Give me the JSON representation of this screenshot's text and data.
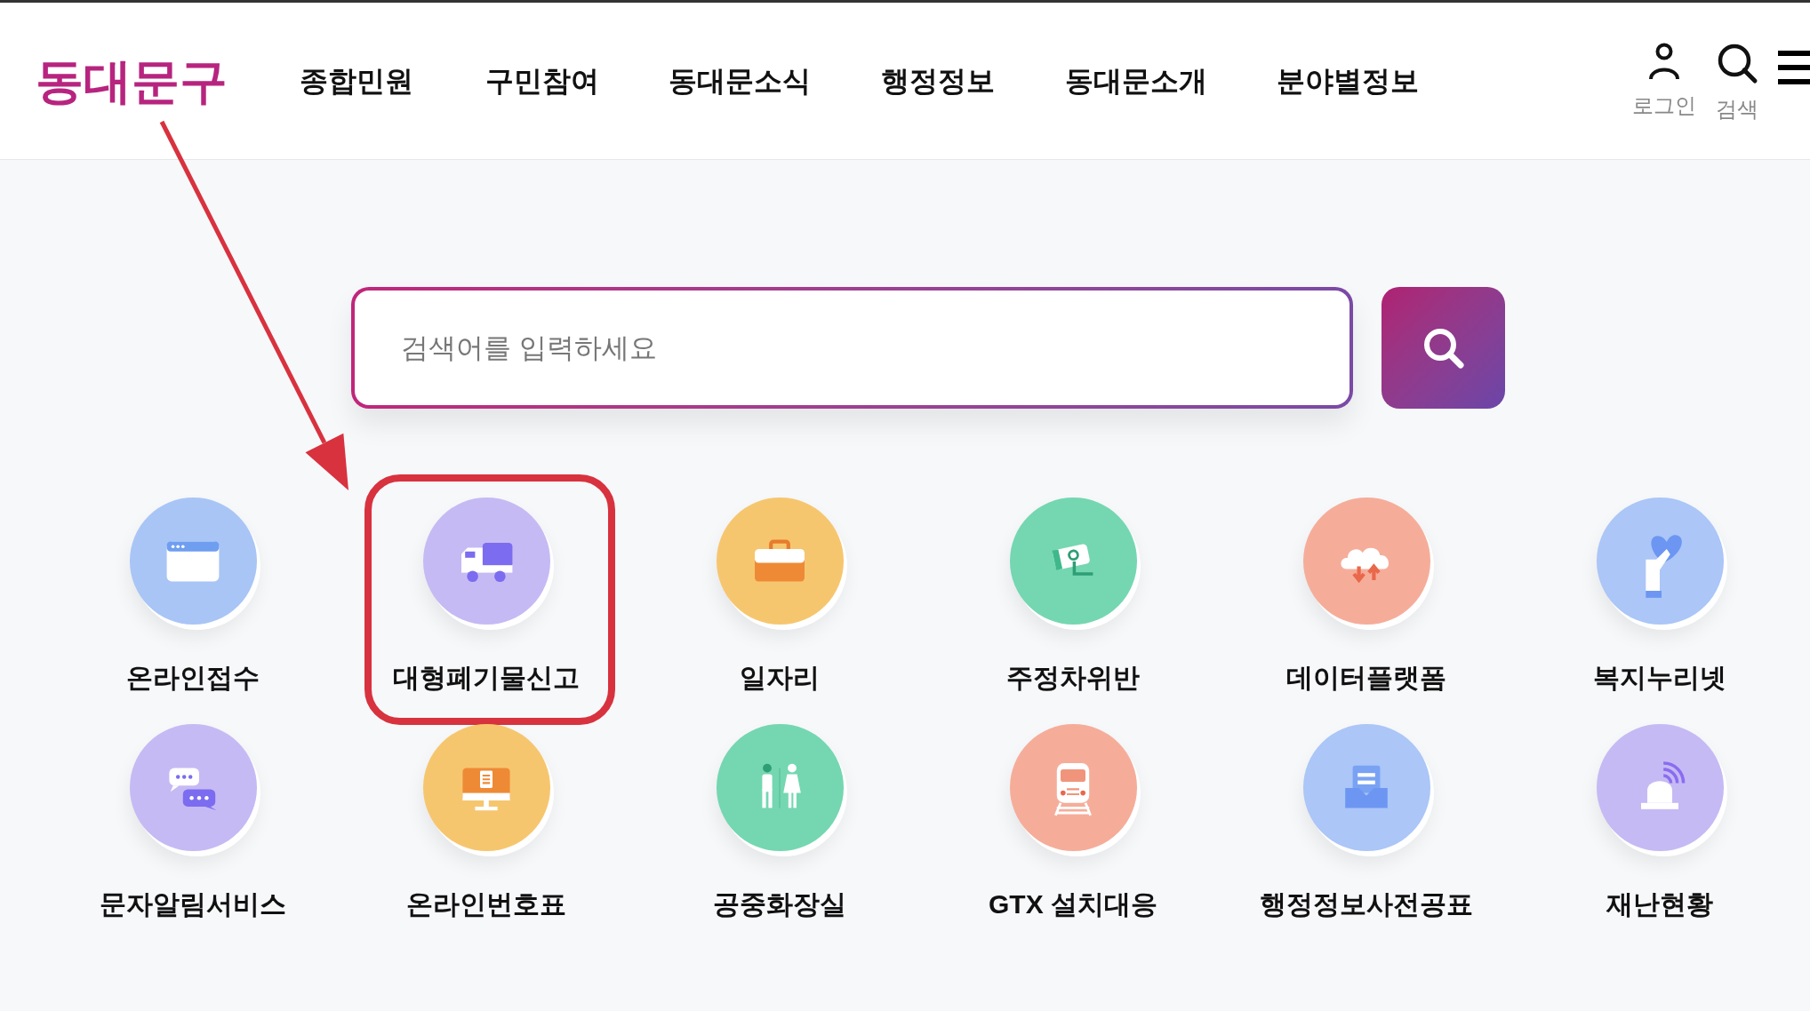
{
  "header": {
    "logo": "동대문구",
    "nav": [
      "종합민원",
      "구민참여",
      "동대문소식",
      "행정정보",
      "동대문소개",
      "분야별정보"
    ],
    "actions": [
      {
        "label": "로그인",
        "kind": "login"
      },
      {
        "label": "검색",
        "kind": "search"
      }
    ]
  },
  "search": {
    "placeholder": "검색어를 입력하세요"
  },
  "services": [
    {
      "label": "온라인접수",
      "color": "#a9c5f6",
      "highlighted": false
    },
    {
      "label": "대형폐기물신고",
      "color": "#c6baf4",
      "highlighted": true
    },
    {
      "label": "일자리",
      "color": "#f6c66f",
      "highlighted": false
    },
    {
      "label": "주정차위반",
      "color": "#74d7b1",
      "highlighted": false
    },
    {
      "label": "데이터플랫폼",
      "color": "#f5ad9a",
      "highlighted": false
    },
    {
      "label": "복지누리넷",
      "color": "#abc6f7",
      "highlighted": false
    },
    {
      "label": "문자알림서비스",
      "color": "#c6baf4",
      "highlighted": false
    },
    {
      "label": "온라인번호표",
      "color": "#f6c66f",
      "highlighted": false
    },
    {
      "label": "공중화장실",
      "color": "#74d7b1",
      "highlighted": false
    },
    {
      "label": "GTX 설치대응",
      "color": "#f5ad9a",
      "highlighted": false
    },
    {
      "label": "행정정보사전공표",
      "color": "#abc6f7",
      "highlighted": false
    },
    {
      "label": "재난현황",
      "color": "#c6baf4",
      "highlighted": false
    }
  ]
}
